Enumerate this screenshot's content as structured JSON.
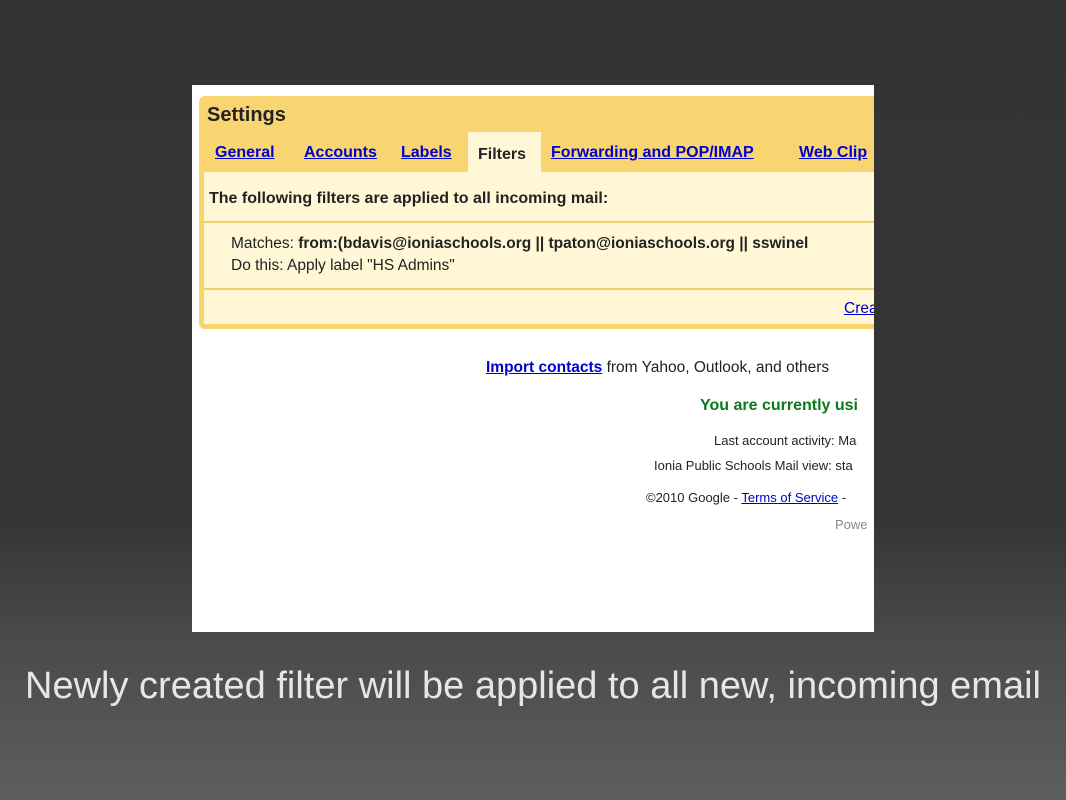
{
  "settings": {
    "title": "Settings",
    "tabs": [
      {
        "label": "General",
        "active": false
      },
      {
        "label": "Accounts",
        "active": false
      },
      {
        "label": "Labels",
        "active": false
      },
      {
        "label": "Filters",
        "active": true
      },
      {
        "label": "Forwarding and POP/IMAP",
        "active": false
      },
      {
        "label": "Web Clip",
        "active": false
      }
    ],
    "filters_heading": "The following filters are applied to all incoming mail:",
    "filter": {
      "matches_label": "Matches: ",
      "matches_value": "from:(bdavis@ioniaschools.org || tpaton@ioniaschools.org || sswinel",
      "action_text": "Do this: Apply label \"HS Admins\""
    },
    "create_link": "Crea"
  },
  "footer": {
    "import_link": "Import contacts",
    "import_rest": " from Yahoo, Outlook, and others",
    "using_text": "You are currently usi",
    "last_activity": "Last account activity: Ma",
    "mail_view": "Ionia Public Schools Mail view: sta",
    "copyright_prefix": "©2010 Google - ",
    "terms_link": "Terms of Service",
    "copyright_suffix": " -",
    "powered": "Powe"
  },
  "caption": "Newly created filter will be applied to all new, incoming email",
  "colors": {
    "panel": "#f9d572",
    "panel_inner": "#fff7d6",
    "link": "#0000cc",
    "status_green": "#0a7a1a"
  }
}
